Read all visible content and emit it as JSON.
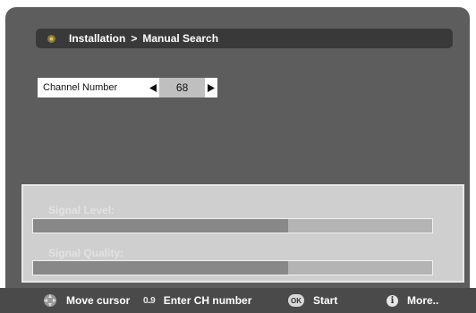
{
  "breadcrumb": {
    "section": "Installation",
    "separator": ">",
    "page": "Manual Search"
  },
  "channel": {
    "label": "Channel Number",
    "value": "68"
  },
  "signal": {
    "level_label": "Signal Level:",
    "level_fraction": 0.64,
    "quality_label": "Signal Quality:",
    "quality_fraction": 0.64
  },
  "footer": {
    "move": "Move cursor",
    "enter": "Enter CH number",
    "numeric_icon_text": "0..9",
    "ok_icon_text": "OK",
    "start": "Start",
    "info_icon_text": "i",
    "more": "More.."
  },
  "colors": {
    "background": "#5d5d5d",
    "panel": "#cfcfcf",
    "bar_fill": "#888888",
    "footer": "#4a4a4a"
  }
}
